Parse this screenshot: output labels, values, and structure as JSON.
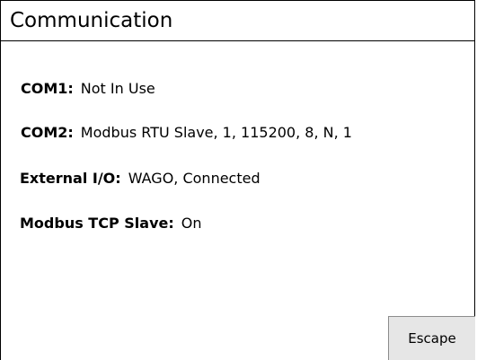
{
  "header": {
    "title": "Communication"
  },
  "settings": [
    {
      "label": "COM1:",
      "value": "Not In Use"
    },
    {
      "label": "COM2:",
      "value": "Modbus RTU Slave, 1, 115200, 8, N, 1"
    },
    {
      "label": "External I/O:",
      "value": "WAGO, Connected"
    },
    {
      "label": "Modbus TCP Slave:",
      "value": "On"
    }
  ],
  "actions": {
    "escape_label": "Escape"
  },
  "colors": {
    "background": "#ffffff",
    "border": "#000000",
    "button_background": "#e6e6e6"
  }
}
